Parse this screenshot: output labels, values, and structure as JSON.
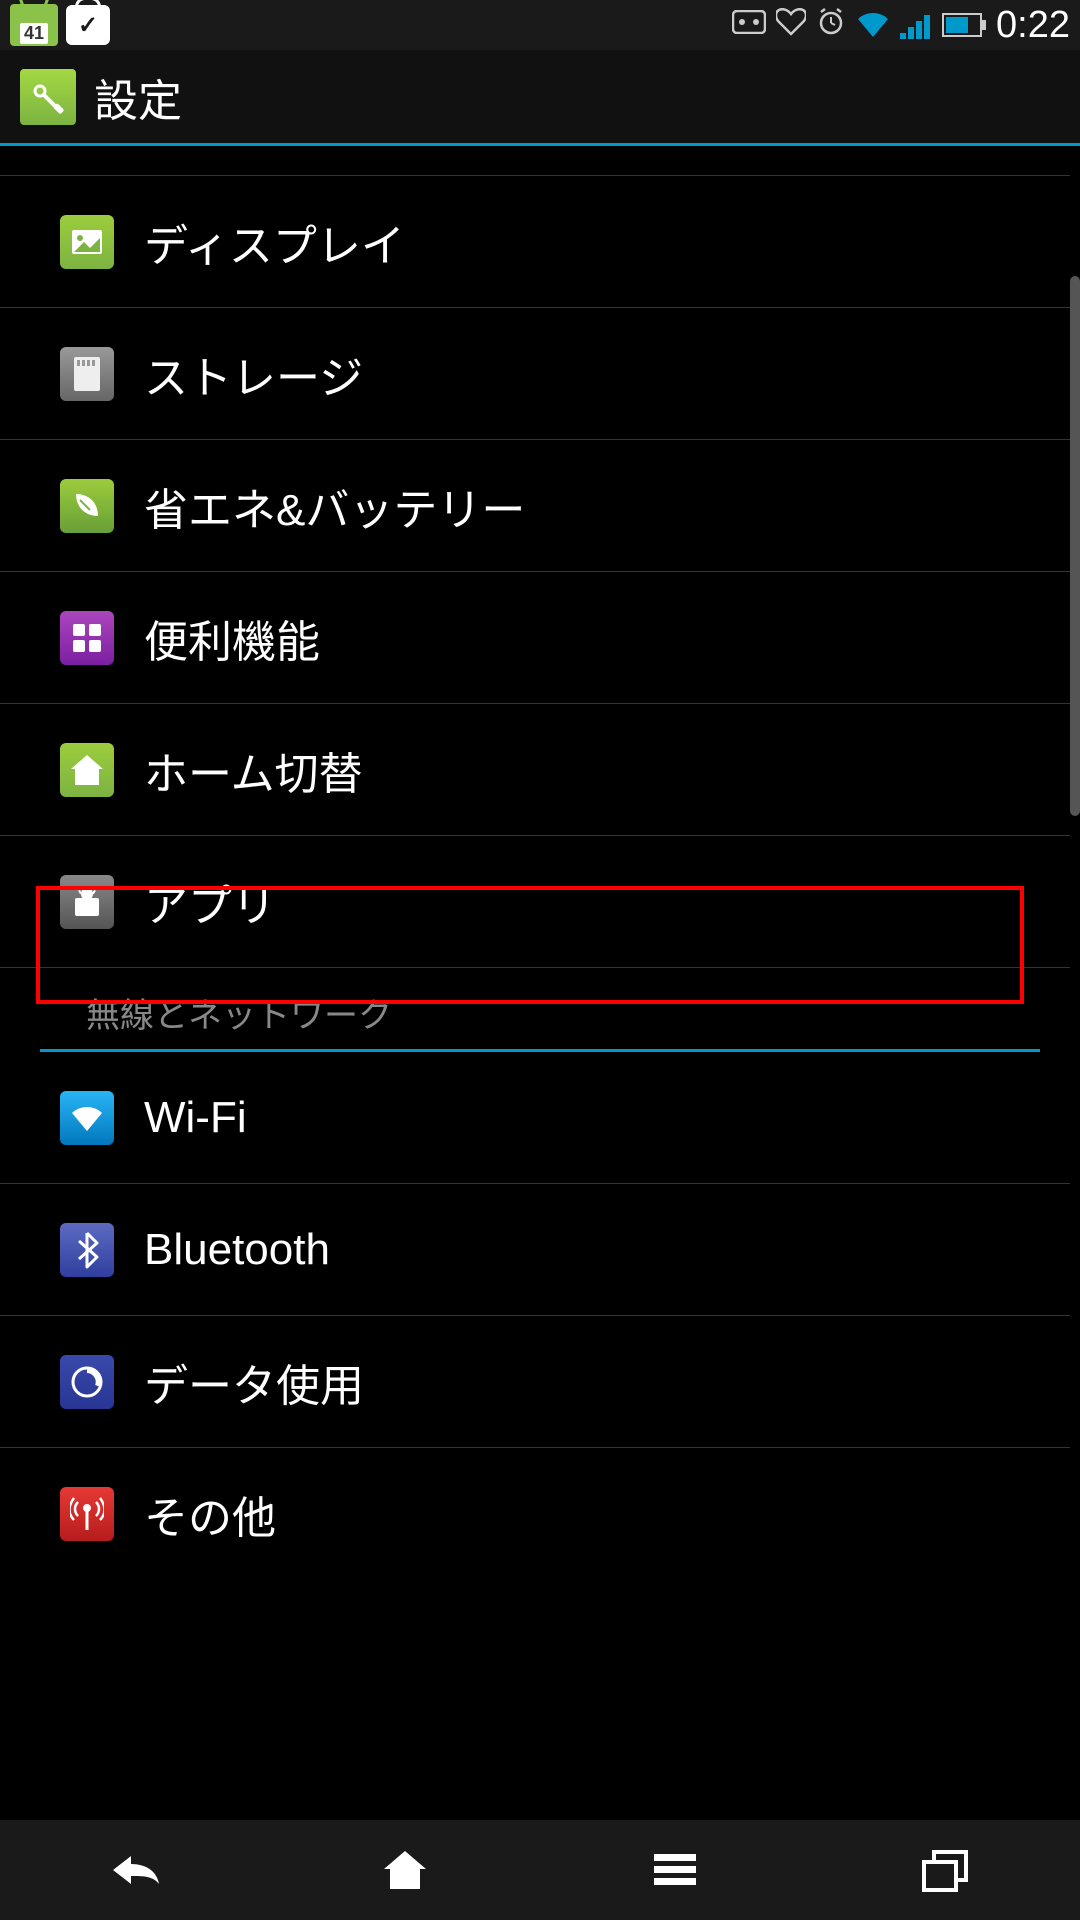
{
  "status": {
    "badge": "41",
    "time": "0:22"
  },
  "header": {
    "title": "設定"
  },
  "items": [
    {
      "label": "ディスプレイ",
      "icon": "display-icon"
    },
    {
      "label": "ストレージ",
      "icon": "storage-icon"
    },
    {
      "label": "省エネ&バッテリー",
      "icon": "battery-icon"
    },
    {
      "label": "便利機能",
      "icon": "utility-icon"
    },
    {
      "label": "ホーム切替",
      "icon": "home-icon"
    },
    {
      "label": "アプリ",
      "icon": "apps-icon"
    }
  ],
  "section": {
    "header": "無線とネットワーク"
  },
  "network_items": [
    {
      "label": "Wi-Fi",
      "icon": "wifi-icon"
    },
    {
      "label": "Bluetooth",
      "icon": "bluetooth-icon"
    },
    {
      "label": "データ使用",
      "icon": "data-icon"
    },
    {
      "label": "その他",
      "icon": "other-icon"
    }
  ],
  "highlighted_item": "アプリ"
}
